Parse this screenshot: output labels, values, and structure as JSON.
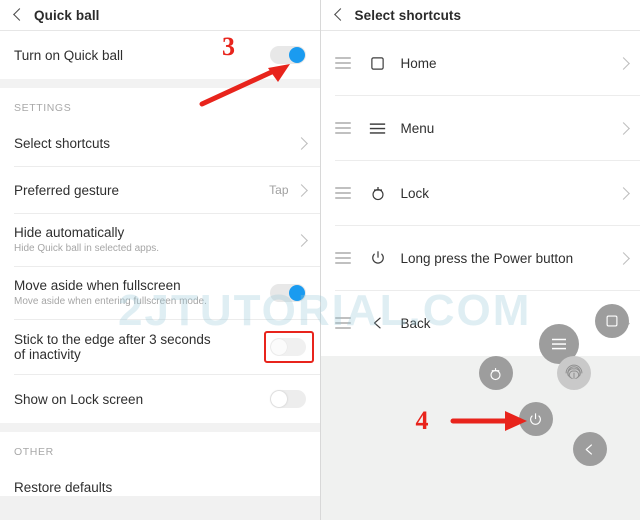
{
  "left": {
    "header": {
      "title": "Quick ball",
      "back_icon": "back-chevron-icon"
    },
    "main_toggle": {
      "label": "Turn on Quick ball",
      "state": "on"
    },
    "section_settings": "SETTINGS",
    "section_other": "OTHER",
    "rows": [
      {
        "title": "Select shortcuts",
        "sub": "",
        "value": "",
        "control": "chevron"
      },
      {
        "title": "Preferred gesture",
        "sub": "",
        "value": "Tap",
        "control": "chevron"
      },
      {
        "title": "Hide automatically",
        "sub": "Hide Quick ball in selected apps.",
        "value": "",
        "control": "chevron"
      },
      {
        "title": "Move aside when fullscreen",
        "sub": "Move aside when entering fullscreen mode.",
        "value": "",
        "control": "toggle-on"
      },
      {
        "title": "Stick to the edge after 3 seconds of inactivity",
        "sub": "",
        "value": "",
        "control": "toggle-blank"
      },
      {
        "title": "Show on Lock screen",
        "sub": "",
        "value": "",
        "control": "toggle-off"
      },
      {
        "title": "Restore defaults",
        "sub": "",
        "value": "",
        "control": "none"
      }
    ]
  },
  "right": {
    "header": {
      "title": "Select shortcuts",
      "back_icon": "back-chevron-icon"
    },
    "shortcuts": [
      {
        "label": "Home",
        "icon": "home-square-icon"
      },
      {
        "label": "Menu",
        "icon": "menu-lines-icon"
      },
      {
        "label": "Lock",
        "icon": "lock-icon"
      },
      {
        "label": "Long press the Power button",
        "icon": "power-icon"
      },
      {
        "label": "Back",
        "icon": "back-chevron-icon"
      }
    ],
    "quickball": {
      "buttons": [
        {
          "name": "recents",
          "icon": "square-icon"
        },
        {
          "name": "center",
          "icon": "menu-lines-icon"
        },
        {
          "name": "lock",
          "icon": "lock-icon"
        },
        {
          "name": "fingerprint",
          "icon": "fingerprint-icon"
        },
        {
          "name": "power",
          "icon": "power-icon"
        },
        {
          "name": "back",
          "icon": "back-chevron-icon"
        }
      ]
    }
  },
  "annotations": {
    "step3": "3",
    "step4": "4",
    "watermark": "2JTUTORIAL.COM"
  }
}
